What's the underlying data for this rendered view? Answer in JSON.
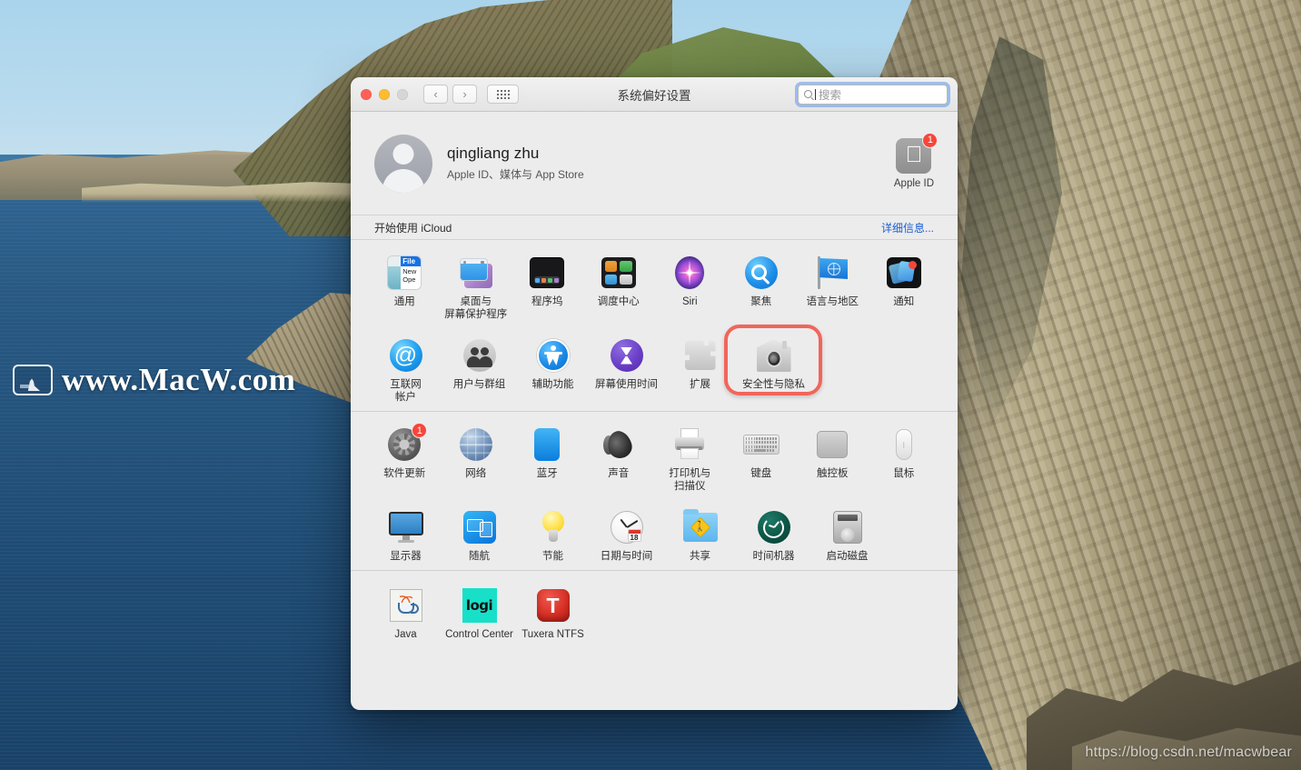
{
  "desktop": {
    "watermark_left": "www.MacW.com",
    "watermark_left_icon": "monitor-logo-icon",
    "watermark_bottom_right": "https://blog.csdn.net/macwbear"
  },
  "window": {
    "title": "系统偏好设置",
    "traffic_lights": {
      "close": "close-button",
      "minimize": "minimize-button",
      "zoom": "zoom-button-disabled"
    },
    "nav": {
      "back_glyph": "‹",
      "forward_glyph": "›",
      "grid_label": "show-all-grid-button"
    },
    "search": {
      "placeholder": "搜索",
      "value": "",
      "focused": true,
      "focus_ring_color": "#5a96eb"
    }
  },
  "account": {
    "name": "qingliang zhu",
    "subtitle": "Apple ID、媒体与 App Store",
    "apple_id_tile": {
      "label": "Apple ID",
      "badge": "1",
      "badge_color": "#f7453a"
    }
  },
  "icloud_banner": {
    "text": "开始使用 iCloud",
    "details_link": "详细信息...",
    "link_color": "#1a5fd4"
  },
  "highlight": {
    "target": "安全性与隐私",
    "color": "#f2655a"
  },
  "sections": [
    {
      "id": "section-1",
      "panes": [
        {
          "label": "通用",
          "icon": "general-icon",
          "general_text": {
            "file": "File",
            "new": "New",
            "open": "Ope"
          }
        },
        {
          "label": "桌面与\n屏幕保护程序",
          "icon": "desktop-screensaver-icon"
        },
        {
          "label": "程序坞",
          "icon": "dock-icon"
        },
        {
          "label": "调度中心",
          "icon": "mission-control-icon"
        },
        {
          "label": "Siri",
          "icon": "siri-icon"
        },
        {
          "label": "聚焦",
          "icon": "spotlight-icon"
        },
        {
          "label": "语言与地区",
          "icon": "language-region-icon"
        },
        {
          "label": "通知",
          "icon": "notifications-icon"
        },
        {
          "label": "互联网\n帐户",
          "icon": "internet-accounts-icon"
        },
        {
          "label": "用户与群组",
          "icon": "users-groups-icon"
        },
        {
          "label": "辅助功能",
          "icon": "accessibility-icon"
        },
        {
          "label": "屏幕使用时间",
          "icon": "screen-time-icon"
        },
        {
          "label": "扩展",
          "icon": "extensions-icon"
        },
        {
          "label": "安全性与隐私",
          "icon": "security-privacy-icon",
          "highlighted": true
        }
      ]
    },
    {
      "id": "section-2",
      "panes": [
        {
          "label": "软件更新",
          "icon": "software-update-icon",
          "badge": "1"
        },
        {
          "label": "网络",
          "icon": "network-icon"
        },
        {
          "label": "蓝牙",
          "icon": "bluetooth-icon"
        },
        {
          "label": "声音",
          "icon": "sound-icon"
        },
        {
          "label": "打印机与\n扫描仪",
          "icon": "printers-scanners-icon"
        },
        {
          "label": "键盘",
          "icon": "keyboard-icon"
        },
        {
          "label": "触控板",
          "icon": "trackpad-icon"
        },
        {
          "label": "鼠标",
          "icon": "mouse-icon"
        },
        {
          "label": "显示器",
          "icon": "displays-icon"
        },
        {
          "label": "随航",
          "icon": "sidecar-icon"
        },
        {
          "label": "节能",
          "icon": "energy-saver-icon"
        },
        {
          "label": "日期与时间",
          "icon": "date-time-icon",
          "cal_day": "18"
        },
        {
          "label": "共享",
          "icon": "sharing-icon"
        },
        {
          "label": "时间机器",
          "icon": "time-machine-icon"
        },
        {
          "label": "启动磁盘",
          "icon": "startup-disk-icon"
        }
      ]
    },
    {
      "id": "section-3",
      "panes": [
        {
          "label": "Java",
          "icon": "java-icon"
        },
        {
          "label": "Control Center",
          "icon": "logitech-control-center-icon",
          "glyph": "logi"
        },
        {
          "label": "Tuxera NTFS",
          "icon": "tuxera-ntfs-icon",
          "glyph": "T"
        }
      ]
    }
  ]
}
